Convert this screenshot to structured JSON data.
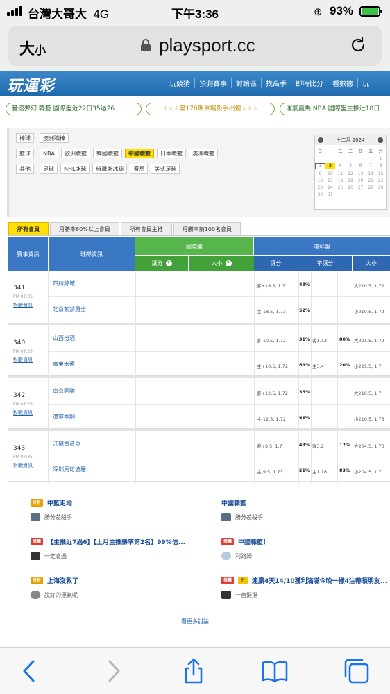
{
  "status_bar": {
    "carrier": "台灣大哥大",
    "network": "4G",
    "time": "下午3:36",
    "battery": "93%",
    "colors": {
      "battery_fill": "#3cc24a"
    }
  },
  "address_bar": {
    "text_size_label": "大",
    "text_size_small": "小",
    "url": "playsport.cc"
  },
  "site": {
    "logo": "玩運彩",
    "nav": [
      "玩競猜",
      "預測賽事",
      "討論區",
      "找高手",
      "即時比分",
      "看數據",
      "玩"
    ],
    "colors": {
      "nav_blue": "#2b78bf",
      "intl_green": "#56b54b",
      "highlight_yellow": "#ffe000"
    }
  },
  "marquee": [
    "音速夢幻 韓籃 國際盤近22日35過26",
    "☆☆☆第170期單場殺手出爐☆☆☆",
    "運氣贏馬 NBA 國際盤主推近18日"
  ],
  "filters": {
    "rows": [
      {
        "label": "棒球",
        "options": [
          "澳洲職棒"
        ]
      },
      {
        "label": "籃球",
        "options": [
          "NBA",
          "歐洲職籃",
          "韓國職籃",
          "中國職籃",
          "日本職籃",
          "澳洲職籃"
        ],
        "active": "中國職籃"
      },
      {
        "label": "其他",
        "options": [
          "足球",
          "NHL冰球",
          "俄羅斯冰球",
          "賽馬",
          "美式足球"
        ]
      }
    ]
  },
  "calendar": {
    "title": "十二月 2024",
    "weekdays": [
      "日",
      "一",
      "二",
      "三",
      "四",
      "五",
      "六"
    ],
    "days": [
      "",
      "",
      "",
      "",
      "",
      "",
      "1",
      "2",
      "3",
      "4",
      "5",
      "6",
      "7",
      "8",
      "9",
      "10",
      "11",
      "12",
      "13",
      "14",
      "15",
      "16",
      "17",
      "18",
      "19",
      "20",
      "21",
      "22",
      "23",
      "24",
      "25",
      "26",
      "27",
      "28",
      "29",
      "30",
      "31",
      "",
      "",
      "",
      "",
      ""
    ],
    "today": "3",
    "selected": "2"
  },
  "tabs": [
    "所有會員",
    "月勝率60%以上會員",
    "所有會員主推",
    "月勝率前100名會員"
  ],
  "table": {
    "headers": {
      "event": "賽事資訊",
      "team": "球隊資訊",
      "intl": "國際盤",
      "intl_handicap": "讓分",
      "intl_ou": "大小",
      "lottery": "運彩盤",
      "lot_handicap": "讓分",
      "lot_nohandicap": "不讓分",
      "lot_ou": "大小"
    },
    "games": [
      {
        "id": "341",
        "time": "PM 07:35",
        "link": "對戰資訊",
        "teams": [
          "四川錦城",
          "北京紫禁勇士"
        ],
        "spread": [
          "客+18.5, 1.7",
          "主-18.5, 1.73"
        ],
        "spread_pct": [
          "48%",
          "52%"
        ],
        "ml": [
          "",
          ""
        ],
        "ml_pct": [
          "",
          ""
        ],
        "ou": [
          "大210.5, 1.72",
          "小210.5, 1.72"
        ]
      },
      {
        "id": "340",
        "time": "PM 07:35",
        "link": "對戰資訊",
        "teams": [
          "山西汾酒",
          "廣東宏遠"
        ],
        "spread": [
          "客-10.5, 1.72",
          "主+10.5, 1.72"
        ],
        "spread_pct": [
          "31%",
          "69%"
        ],
        "ml": [
          "客1.13",
          "主3.4"
        ],
        "ml_pct": [
          "80%",
          "20%"
        ],
        "ou": [
          "大221.5, 1.72",
          "小221.5, 1.7"
        ]
      },
      {
        "id": "342",
        "time": "PM 07:35",
        "link": "對戰資訊",
        "teams": [
          "南京同曦",
          "遼寧本鋼"
        ],
        "spread": [
          "客+12.5, 1.72",
          "主-12.5, 1.72"
        ],
        "spread_pct": [
          "35%",
          "65%"
        ],
        "ml": [
          "",
          ""
        ],
        "ml_pct": [
          "",
          ""
        ],
        "ou": [
          "大210.5, 1.7",
          "小210.5, 1.73"
        ]
      },
      {
        "id": "343",
        "time": "PM 07:35",
        "link": "對戰資訊",
        "teams": [
          "江蘇肯帝亞",
          "深圳馬可波羅"
        ],
        "spread": [
          "客+9.5, 1.7",
          "主-9.5, 1.73"
        ],
        "spread_pct": [
          "49%",
          "51%"
        ],
        "ml": [
          "客3.2",
          "主1.16"
        ],
        "ml_pct": [
          "17%",
          "83%"
        ],
        "ou": [
          "大204.5, 1.73",
          "小204.5, 1.7"
        ]
      }
    ]
  },
  "discussions": [
    {
      "tag": "分析",
      "title": "中藍走地",
      "user": "勝分差殺手"
    },
    {
      "tag": "",
      "title": "中國職籃",
      "user": "勝分差殺手"
    },
    {
      "tag": "推薦",
      "title": "【主推近7過6】【上月主推勝率第2名】99%信...",
      "user": "一定會過"
    },
    {
      "tag": "推薦",
      "title": "中國職籃！",
      "user": "利路姆"
    },
    {
      "tag": "分析",
      "title": "上海沒救了",
      "user": "說好的運氣呢"
    },
    {
      "tag": "推薦",
      "tag2": "分",
      "title": "連贏4天14/10獲利滿滿今晚一樣4注帶領朋友...",
      "user": "一直挺挺"
    }
  ],
  "more_link": "看更多討論"
}
